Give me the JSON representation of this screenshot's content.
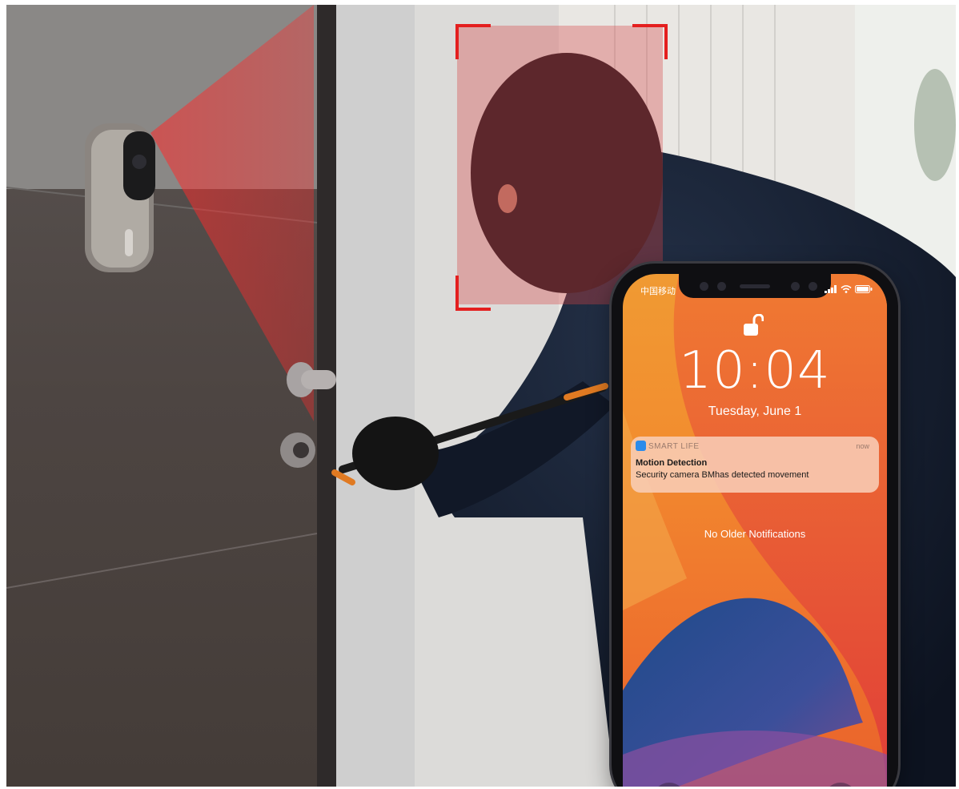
{
  "phone": {
    "carrier": "中国移动",
    "time": "10:04",
    "date": "Tuesday, June 1",
    "notification": {
      "app_name": "SMART LIFE",
      "timestamp": "now",
      "title": "Motion Detection",
      "body": "Security camera BMhas detected movement"
    },
    "no_older_text": "No Older Notifications"
  },
  "colors": {
    "detection_red": "#e41f1f",
    "wallpaper_orange": "#f08a30",
    "wallpaper_red": "#e2403a",
    "wallpaper_blue": "#2a4f8f"
  },
  "icons": {
    "lock": "unlocked-padlock-icon",
    "flashlight": "flashlight-icon",
    "camera": "camera-icon"
  }
}
